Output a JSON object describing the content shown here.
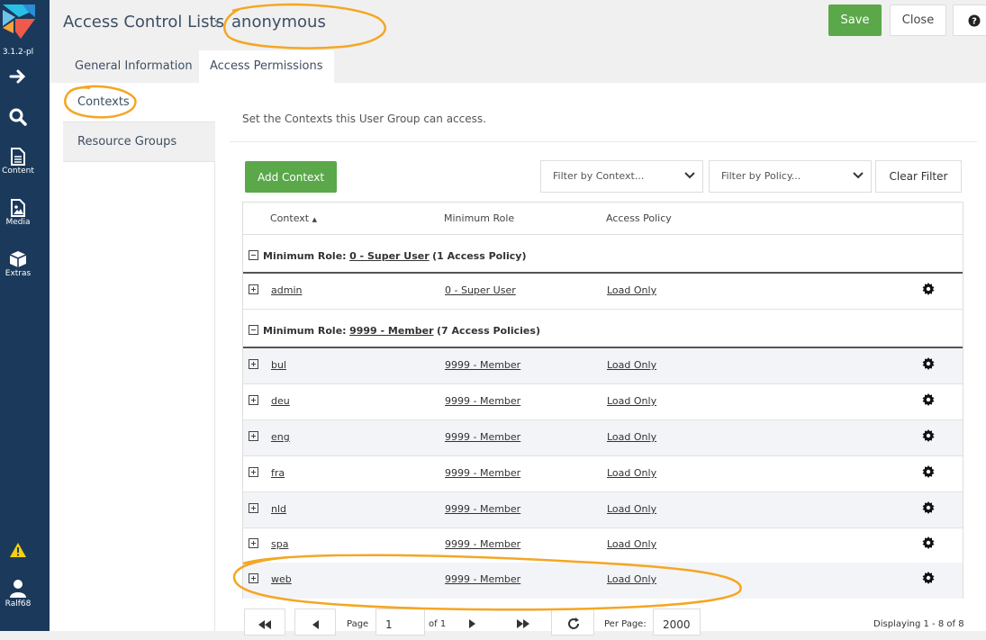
{
  "app": {
    "version": "3.1.2-pl",
    "nav": [
      {
        "label": "",
        "icon": "arrow-right-icon"
      },
      {
        "label": "",
        "icon": "search-icon"
      },
      {
        "label": "Content",
        "icon": "document-icon"
      },
      {
        "label": "Media",
        "icon": "media-file-icon"
      },
      {
        "label": "Extras",
        "icon": "cube-icon"
      }
    ],
    "user": {
      "name": "Ralf68",
      "icon": "user-icon"
    },
    "warning_icon": "warning-icon",
    "colors": {
      "sidebar": "#1b3a5b",
      "accent_green": "#5aa84a",
      "annotation": "#f5a623"
    }
  },
  "header": {
    "breadcrumb_root": "Access Control Lists",
    "separator": "›",
    "title": "anonymous",
    "save_label": "Save",
    "close_label": "Close",
    "help_icon": "question-circle-icon"
  },
  "tabs": [
    {
      "label": "General Information",
      "active": false
    },
    {
      "label": "Access Permissions",
      "active": true
    }
  ],
  "subtabs": [
    {
      "label": "Contexts",
      "active": true
    },
    {
      "label": "Resource Groups",
      "active": false
    }
  ],
  "intro_text": "Set the Contexts this User Group can access.",
  "toolbar": {
    "add_label": "Add Context",
    "filter_context_placeholder": "Filter by Context...",
    "filter_policy_placeholder": "Filter by Policy...",
    "clear_label": "Clear Filter"
  },
  "grid": {
    "columns": [
      "Context",
      "Minimum Role",
      "Access Policy"
    ],
    "sort_indicator": "▲",
    "groups": [
      {
        "prefix": "Minimum Role:",
        "role": "0 - Super User",
        "suffix": "(1 Access Policy)"
      },
      {
        "prefix": "Minimum Role:",
        "role": "9999 - Member",
        "suffix": "(7 Access Policies)"
      }
    ],
    "rows": [
      {
        "context": "admin",
        "role": "0 - Super User",
        "policy": "Load Only"
      },
      {
        "context": "bul",
        "role": "9999 - Member",
        "policy": "Load Only"
      },
      {
        "context": "deu",
        "role": "9999 - Member",
        "policy": "Load Only"
      },
      {
        "context": "eng",
        "role": "9999 - Member",
        "policy": "Load Only"
      },
      {
        "context": "fra",
        "role": "9999 - Member",
        "policy": "Load Only"
      },
      {
        "context": "nld",
        "role": "9999 - Member",
        "policy": "Load Only"
      },
      {
        "context": "spa",
        "role": "9999 - Member",
        "policy": "Load Only"
      },
      {
        "context": "web",
        "role": "9999 - Member",
        "policy": "Load Only"
      }
    ]
  },
  "pager": {
    "page_label": "Page",
    "page_value": "1",
    "of_label": "of 1",
    "per_page_label": "Per Page:",
    "per_page_value": "2000",
    "displaying": "Displaying 1 - 8 of 8"
  }
}
